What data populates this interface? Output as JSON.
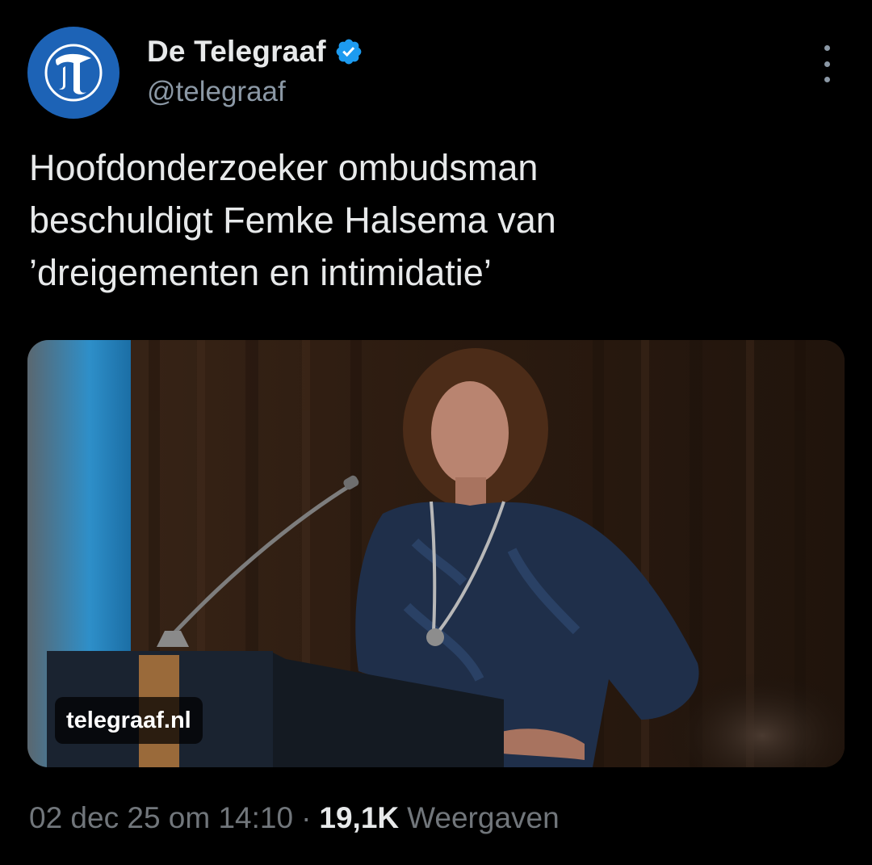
{
  "author": {
    "display_name": "De Telegraaf",
    "handle": "@telegraaf",
    "verified": true,
    "avatar_icon": "telegraaf-t-logo-icon",
    "avatar_color": "#1d63b6"
  },
  "tweet": {
    "text": "Hoofdonderzoeker ombudsman\nbeschuldigt Femke Halsema van\n’dreigementen en intimidatie’"
  },
  "media": {
    "domain_label": "telegraaf.nl"
  },
  "meta": {
    "timestamp": "02 dec 25 om 14:10",
    "separator": "·",
    "views_count": "19,1K",
    "views_label": "Weergaven"
  },
  "colors": {
    "verified_blue": "#1d9bf0",
    "text_primary": "#e7e9ea",
    "text_secondary": "#71767b"
  }
}
